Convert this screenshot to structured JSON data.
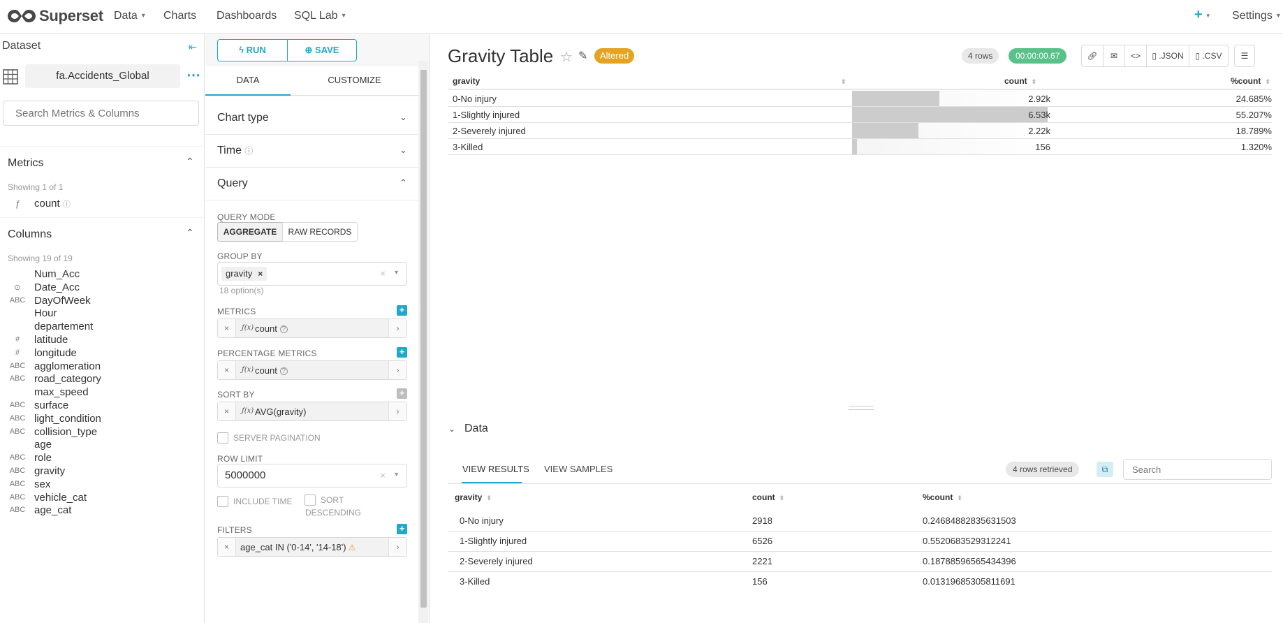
{
  "nav": {
    "brand": "Superset",
    "items": [
      {
        "label": "Data",
        "has_caret": true
      },
      {
        "label": "Charts",
        "has_caret": false
      },
      {
        "label": "Dashboards",
        "has_caret": false
      },
      {
        "label": "SQL Lab",
        "has_caret": true
      }
    ],
    "plus": "+",
    "settings": "Settings"
  },
  "dataset_panel": {
    "title": "Dataset",
    "dataset_name": "fa.Accidents_Global",
    "search_placeholder": "Search Metrics & Columns",
    "metrics_title": "Metrics",
    "metrics_showing": "Showing 1 of 1",
    "metrics": [
      {
        "type": "ƒ",
        "name": "count"
      }
    ],
    "columns_title": "Columns",
    "columns_showing": "Showing 19 of 19",
    "columns": [
      {
        "type": "",
        "name": "Num_Acc"
      },
      {
        "type": "⊙",
        "name": "Date_Acc"
      },
      {
        "type": "ABC",
        "name": "DayOfWeek"
      },
      {
        "type": "",
        "name": "Hour"
      },
      {
        "type": "",
        "name": "departement"
      },
      {
        "type": "#",
        "name": "latitude"
      },
      {
        "type": "#",
        "name": "longitude"
      },
      {
        "type": "ABC",
        "name": "agglomeration"
      },
      {
        "type": "ABC",
        "name": "road_category"
      },
      {
        "type": "",
        "name": "max_speed"
      },
      {
        "type": "ABC",
        "name": "surface"
      },
      {
        "type": "ABC",
        "name": "light_condition"
      },
      {
        "type": "ABC",
        "name": "collision_type"
      },
      {
        "type": "",
        "name": "age"
      },
      {
        "type": "ABC",
        "name": "role"
      },
      {
        "type": "ABC",
        "name": "gravity"
      },
      {
        "type": "ABC",
        "name": "sex"
      },
      {
        "type": "ABC",
        "name": "vehicle_cat"
      },
      {
        "type": "ABC",
        "name": "age_cat"
      }
    ]
  },
  "control_panel": {
    "run_label": "RUN",
    "save_label": "SAVE",
    "tab_data": "DATA",
    "tab_customize": "CUSTOMIZE",
    "chart_type_label": "Chart type",
    "time_label": "Time",
    "query_label": "Query",
    "query_mode_label": "QUERY MODE",
    "mode_aggregate": "AGGREGATE",
    "mode_raw": "RAW RECORDS",
    "group_by_label": "GROUP BY",
    "group_by_value": "gravity",
    "group_by_options": "18 option(s)",
    "metrics_label": "METRICS",
    "metrics_value": "count",
    "percentage_metrics_label": "PERCENTAGE METRICS",
    "percentage_metrics_value": "count",
    "sort_by_label": "SORT BY",
    "sort_by_value": "AVG(gravity)",
    "server_pagination_label": "SERVER PAGINATION",
    "row_limit_label": "ROW LIMIT",
    "row_limit_value": "5000000",
    "include_time_label": "INCLUDE TIME",
    "sort_descending_label_1": "SORT",
    "sort_descending_label_2": "DESCENDING",
    "filters_label": "FILTERS",
    "filter_value": "age_cat IN ('0-14', '14-18')",
    "fx_glyph": "ƒ(x)"
  },
  "chart": {
    "title": "Gravity Table",
    "altered_label": "Altered",
    "rows_badge": "4 rows",
    "time_badge": "00:00:00.67",
    "toolbar": {
      "json": ".JSON",
      "csv": ".CSV"
    },
    "columns": [
      "gravity",
      "count",
      "%count"
    ],
    "rows": [
      {
        "gravity": "0-No injury",
        "count": "2.92k",
        "pct": "24.685%",
        "bar_fraction": 0.447
      },
      {
        "gravity": "1-Slightly injured",
        "count": "6.53k",
        "pct": "55.207%",
        "bar_fraction": 1.0
      },
      {
        "gravity": "2-Severely injured",
        "count": "2.22k",
        "pct": "18.789%",
        "bar_fraction": 0.34
      },
      {
        "gravity": "3-Killed",
        "count": "156",
        "pct": "1.320%",
        "bar_fraction": 0.024
      }
    ]
  },
  "data_pane": {
    "title": "Data",
    "tab_results": "VIEW RESULTS",
    "tab_samples": "VIEW SAMPLES",
    "retrieved": "4 rows retrieved",
    "search_placeholder": "Search",
    "columns": [
      "gravity",
      "count",
      "%count"
    ],
    "rows": [
      {
        "gravity": "0-No injury",
        "count": "2918",
        "pct": "0.24684882835631503"
      },
      {
        "gravity": "1-Slightly injured",
        "count": "6526",
        "pct": "0.5520683529312241"
      },
      {
        "gravity": "2-Severely injured",
        "count": "2221",
        "pct": "0.18788596565434396"
      },
      {
        "gravity": "3-Killed",
        "count": "156",
        "pct": "0.01319685305811691"
      }
    ]
  },
  "colors": {
    "accent": "#20a7c9",
    "altered": "#e4a321",
    "success": "#5ac189",
    "bar": "#cccccc"
  }
}
